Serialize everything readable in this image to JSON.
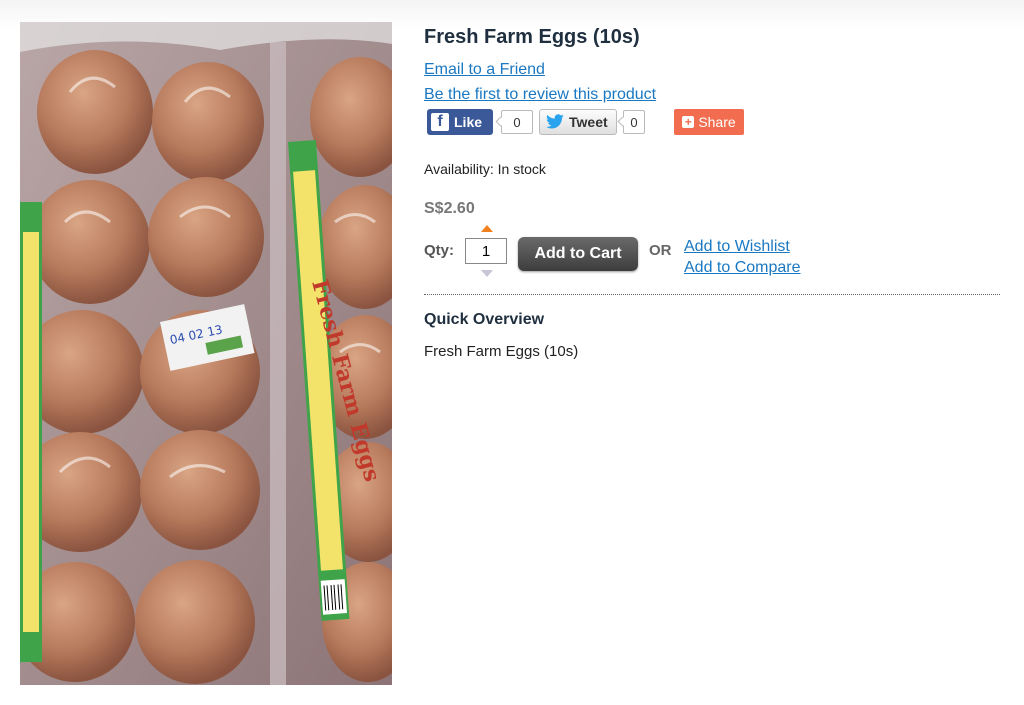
{
  "product": {
    "title": "Fresh Farm Eggs (10s)",
    "image_alt": "Fresh Farm Eggs tray",
    "label_text": "Fresh Farm Eggs"
  },
  "links": {
    "email_friend": "Email to a Friend",
    "review": "Be the first to review this product",
    "wishlist": "Add to Wishlist",
    "compare": "Add to Compare"
  },
  "social": {
    "like_label": "Like",
    "like_count": "0",
    "tweet_label": "Tweet",
    "tweet_count": "0",
    "share_label": "Share"
  },
  "availability": "Availability: In stock",
  "price": "S$2.60",
  "qty": {
    "label": "Qty:",
    "value": "1"
  },
  "cart_button": "Add to Cart",
  "or_text": "OR",
  "overview": {
    "heading": "Quick Overview",
    "text": "Fresh Farm Eggs (10s)"
  },
  "colors": {
    "link": "#1a78c2",
    "facebook": "#3b5998",
    "share": "#f26c4f",
    "title": "#1f2f3f"
  }
}
